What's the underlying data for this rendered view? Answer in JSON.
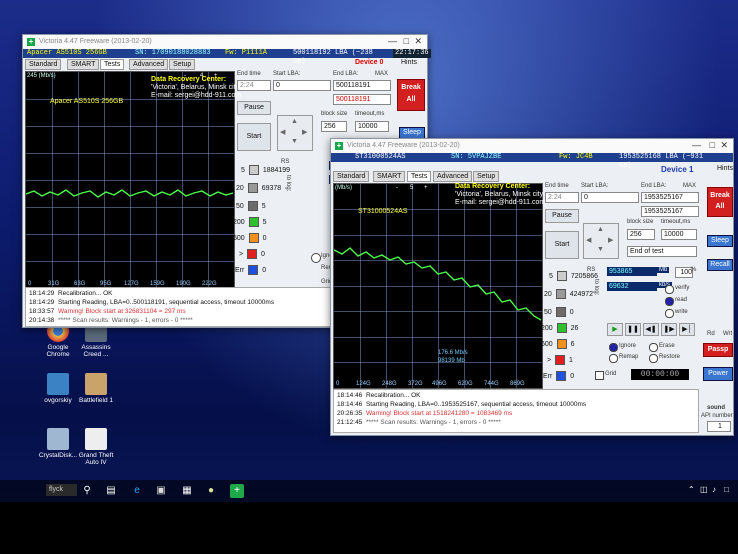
{
  "desktop": {
    "icons": [
      {
        "label": "Google Chrome",
        "color": "#e8c34a"
      },
      {
        "label": "Assassins Creed ...",
        "color": "#5a6a7a"
      },
      {
        "label": "ovgorskiy",
        "color": "#3b82c4"
      },
      {
        "label": "Battlefield 1",
        "color": "#c9a36a"
      },
      {
        "label": "CrystalDisk...",
        "color": "#9fb7d0"
      },
      {
        "label": "Grand Theft Auto IV",
        "color": "#eeeeee"
      }
    ],
    "taskbar": {
      "search_text": "flyck"
    }
  },
  "window1": {
    "title": "Victoria 4.47 Freeware (2013-02-20)",
    "model": "Apacer AS510S 256GB",
    "serial": "SN: 17090188028883",
    "firmware": "Fw: P1111A",
    "lba": "500118192 LBA (~238 GB)",
    "device": "Device 0",
    "clock": "22:17:36",
    "hints": "Hints",
    "tabs": [
      "Standard",
      "SMART",
      "Tests",
      "Advanced",
      "Setup"
    ],
    "active_tab": "Tests",
    "graph_label": "Apacer AS510S 256GB",
    "graph_ymax": "245 (Mb/s)",
    "graph_minus": "-",
    "graph_num": "4",
    "graph_plus": "+",
    "x_ticks": [
      "0",
      "31G",
      "63G",
      "95G",
      "127G",
      "159G",
      "190G",
      "222G"
    ],
    "drc_title": "Data Recovery Center:",
    "drc_city": "'Victoria', Belarus, Minsk city",
    "drc_email": "E-mail: sergei@hdd-911.com",
    "end_time_label": "End time",
    "end_time": "2:24",
    "start_lba_label": "Start LBA:",
    "start_lba": "0",
    "end_lba_label": "End LBA:",
    "max_label": "MAX",
    "end_lba": "500118191",
    "end_lba2": "500118191",
    "pause": "Pause",
    "start": "Start",
    "block_size_label": "block size",
    "block_size": "256",
    "timeout_label": "timeout,ms",
    "timeout": "10000",
    "break_all": "Break All",
    "sleep": "Sleep",
    "rs": "RS",
    "to_log": "to log:",
    "stat1": "24415",
    "stat2": "13926",
    "counters": [
      {
        "label": "5",
        "value": "1884199"
      },
      {
        "label": "20",
        "value": "69378"
      },
      {
        "label": "50",
        "value": "5"
      },
      {
        "label": "200",
        "value": "5"
      },
      {
        "label": "600",
        "value": "0"
      },
      {
        "label": ">",
        "value": "0"
      },
      {
        "label": "Err",
        "value": "0"
      }
    ],
    "ignore": "Ignore",
    "remap": "Remap",
    "grid": "Grid",
    "log": [
      {
        "time": "18:14:29",
        "msg": "Recalibration... OK"
      },
      {
        "time": "18:14:29",
        "msg": "Starting Reading, LBA=0..500118191, sequential access, timeout 10000ms"
      },
      {
        "time": "18:33:57",
        "msg": "Warning! Block start at 326831104 = 297 ms"
      },
      {
        "time": "20:14:38",
        "msg": "***** Scan results: Warnings - 1, errors - 0 *****"
      }
    ]
  },
  "window2": {
    "title": "Victoria 4.47 Freeware (2013-02-20)",
    "model": "ST31000524AS",
    "serial": "SN: 5VPAJZBE",
    "firmware": "Fw: JC4B",
    "lba": "1953525168 LBA (~931 GB)",
    "device": "Device 1",
    "hints": "Hints",
    "tabs": [
      "Standard",
      "SMART",
      "Tests",
      "Advanced",
      "Setup"
    ],
    "active_tab": "Tests",
    "graph_label": "ST31000524AS",
    "graph_ymax": "(Mb/s)",
    "graph_minus": "-",
    "graph_num": "5",
    "graph_plus": "+",
    "speed_note1": "176.6 Mb/s",
    "speed_note2": "98139 Mb",
    "x_ticks": [
      "0",
      "124G",
      "248G",
      "372G",
      "496G",
      "620G",
      "744G",
      "869G"
    ],
    "drc_title": "Data Recovery Center:",
    "drc_city": "'Victoria', Belarus, Minsk city",
    "drc_email": "E-mail: sergei@hdd-911.com",
    "end_time_label": "End time",
    "end_time": "2:24",
    "start_lba_label": "Start LBA:",
    "start_lba": "0",
    "end_lba_label": "End LBA:",
    "max_label": "MAX",
    "end_lba": "1953525167",
    "end_lba2": "1953525167",
    "pause": "Pause",
    "start": "Start",
    "block_size_label": "block size",
    "block_size": "256",
    "timeout_label": "timeout,ms",
    "timeout": "10000",
    "end_of_test": "End of test",
    "break_all": "Break All",
    "sleep": "Sleep",
    "recall": "Recall",
    "passp": "Passp",
    "power": "Power",
    "sound": "sound",
    "api_number_label": "API number",
    "api_number": "1",
    "rd": "Rd",
    "wrt": "Wrt",
    "rs": "RS",
    "to_log": "to log:",
    "mb_value": "953865",
    "mb_unit": "Mb",
    "percent": "100",
    "percent_unit": "%",
    "speed_value": "69632",
    "speed_unit": "kb/s",
    "verify": "verify",
    "read": "read",
    "write": "write",
    "counters": [
      {
        "label": "5",
        "value": "7205866"
      },
      {
        "label": "20",
        "value": "424972"
      },
      {
        "label": "50",
        "value": "0"
      },
      {
        "label": "200",
        "value": "26"
      },
      {
        "label": "600",
        "value": "6"
      },
      {
        "label": ">",
        "value": "1"
      },
      {
        "label": "Err",
        "value": "0"
      }
    ],
    "ignore": "Ignore",
    "erase": "Erase",
    "remap": "Remap",
    "restore": "Restore",
    "grid": "Grid",
    "timer": "00:00:00",
    "log": [
      {
        "time": "18:14:46",
        "msg": "Recalibration... OK"
      },
      {
        "time": "18:14:46",
        "msg": "Starting Reading, LBA=0..1953525167, sequential access, timeout 10000ms"
      },
      {
        "time": "20:26:35",
        "msg": "Warning! Block start at 1518241280 = 1083469 ms"
      },
      {
        "time": "21:12:45",
        "msg": "***** Scan results: Warnings - 1, errors - 0 *****"
      }
    ]
  }
}
